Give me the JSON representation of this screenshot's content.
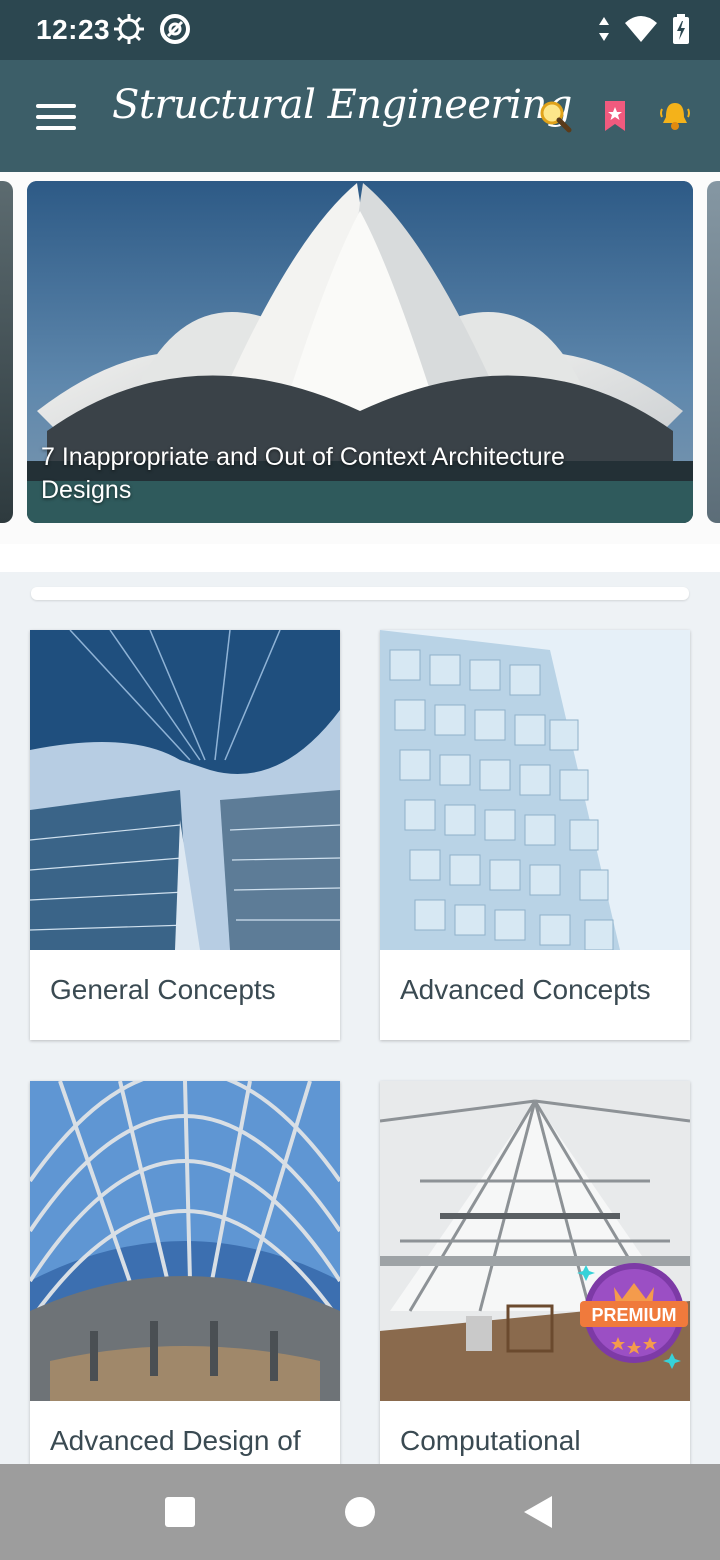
{
  "status_bar": {
    "time": "12:23",
    "left_icons": [
      "gear-status-icon",
      "at-sign-status-icon"
    ],
    "right_icons": [
      "data-arrows-icon",
      "wifi-icon",
      "battery-charging-icon"
    ]
  },
  "app_bar": {
    "title": "Structural Engineering",
    "menu_icon": "hamburger-menu-icon",
    "actions": [
      "search-icon",
      "bookmark-icon",
      "notification-bell-icon"
    ]
  },
  "carousel": {
    "slides": [
      {
        "caption": "7 Inappropriate and Out of Context Architecture Designs"
      }
    ]
  },
  "categories": [
    {
      "label": "General Concepts",
      "premium": false
    },
    {
      "label": "Advanced Concepts",
      "premium": false
    },
    {
      "label": "Advanced Design of",
      "premium": false
    },
    {
      "label": "Computational",
      "premium": true
    }
  ],
  "premium_badge": {
    "label": "PREMIUM"
  },
  "colors": {
    "status_bar": "#2c4750",
    "app_bar": "#3c5e68",
    "background": "#eef2f5",
    "card_text": "#3a4a52",
    "premium_purple": "#8e3fb8",
    "premium_orange": "#f07a3c"
  },
  "nav_bar": {
    "buttons": [
      "recents-square-icon",
      "home-circle-icon",
      "back-triangle-icon"
    ]
  }
}
